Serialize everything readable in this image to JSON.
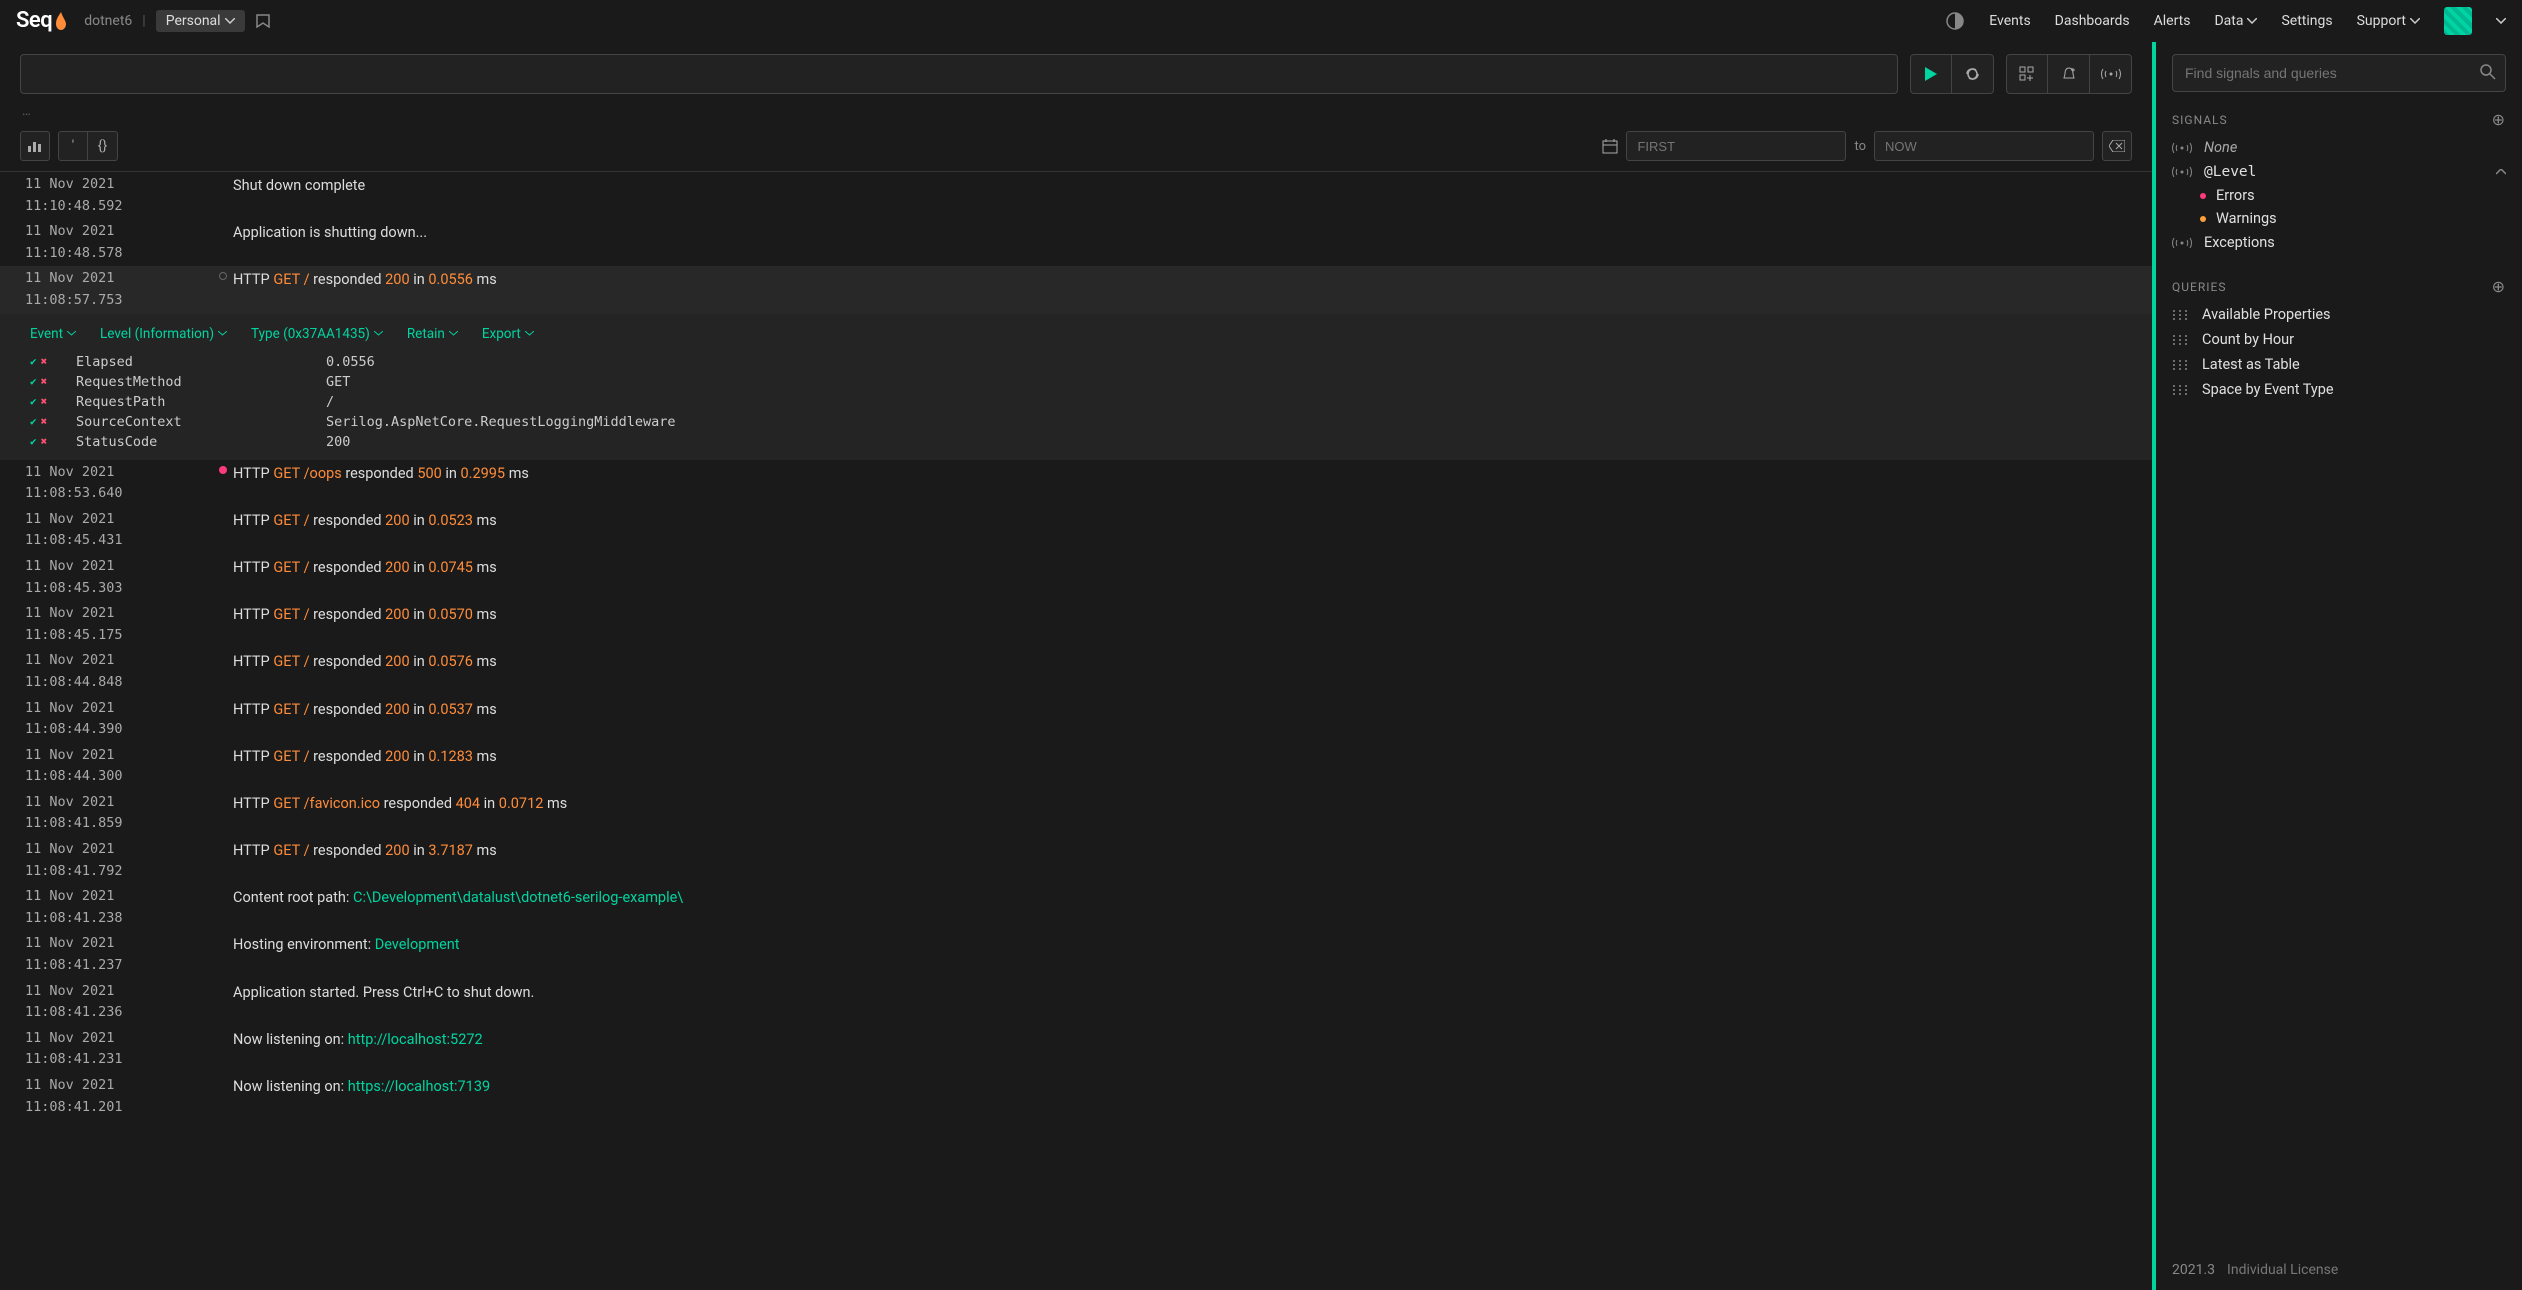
{
  "nav": {
    "brand": "Seq",
    "workspace": "dotnet6",
    "profile": "Personal",
    "links": {
      "events": "Events",
      "dashboards": "Dashboards",
      "alerts": "Alerts",
      "data": "Data",
      "settings": "Settings",
      "support": "Support"
    }
  },
  "search": {
    "query": "",
    "ellipsis": "…",
    "from_placeholder": "FIRST",
    "to_label": "to",
    "to_placeholder": "NOW"
  },
  "detail_menu": {
    "event": "Event",
    "level": "Level (Information)",
    "type": "Type (0x37AA1435)",
    "retain": "Retain",
    "export": "Export"
  },
  "props": [
    {
      "name": "Elapsed",
      "value": "0.0556"
    },
    {
      "name": "RequestMethod",
      "value": "GET"
    },
    {
      "name": "RequestPath",
      "value": "/"
    },
    {
      "name": "SourceContext",
      "value": "Serilog.AspNetCore.RequestLoggingMiddleware"
    },
    {
      "name": "StatusCode",
      "value": "200"
    }
  ],
  "events": {
    "e0": {
      "ts": "11 Nov 2021 11:10:48.592",
      "text": "Shut down complete"
    },
    "e1": {
      "ts": "11 Nov 2021 11:10:48.578",
      "text": "Application is shutting down..."
    },
    "e2": {
      "ts": "11 Nov 2021 11:08:57.753",
      "pre": "HTTP ",
      "method": "GET",
      "sep": " ",
      "path": "/",
      "mid": " responded ",
      "code": "200",
      "in": " in ",
      "ms": "0.0556",
      "suffix": " ms"
    },
    "e3": {
      "ts": "11 Nov 2021 11:08:53.640",
      "pre": "HTTP ",
      "method": "GET",
      "sep": " ",
      "path": "/oops",
      "mid": " responded ",
      "code": "500",
      "in": " in ",
      "ms": "0.2995",
      "suffix": " ms"
    },
    "e4": {
      "ts": "11 Nov 2021 11:08:45.431",
      "pre": "HTTP ",
      "method": "GET",
      "sep": " ",
      "path": "/",
      "mid": " responded ",
      "code": "200",
      "in": " in ",
      "ms": "0.0523",
      "suffix": " ms"
    },
    "e5": {
      "ts": "11 Nov 2021 11:08:45.303",
      "pre": "HTTP ",
      "method": "GET",
      "sep": " ",
      "path": "/",
      "mid": " responded ",
      "code": "200",
      "in": " in ",
      "ms": "0.0745",
      "suffix": " ms"
    },
    "e6": {
      "ts": "11 Nov 2021 11:08:45.175",
      "pre": "HTTP ",
      "method": "GET",
      "sep": " ",
      "path": "/",
      "mid": " responded ",
      "code": "200",
      "in": " in ",
      "ms": "0.0570",
      "suffix": " ms"
    },
    "e7": {
      "ts": "11 Nov 2021 11:08:44.848",
      "pre": "HTTP ",
      "method": "GET",
      "sep": " ",
      "path": "/",
      "mid": " responded ",
      "code": "200",
      "in": " in ",
      "ms": "0.0576",
      "suffix": " ms"
    },
    "e8": {
      "ts": "11 Nov 2021 11:08:44.390",
      "pre": "HTTP ",
      "method": "GET",
      "sep": " ",
      "path": "/",
      "mid": " responded ",
      "code": "200",
      "in": " in ",
      "ms": "0.0537",
      "suffix": " ms"
    },
    "e9": {
      "ts": "11 Nov 2021 11:08:44.300",
      "pre": "HTTP ",
      "method": "GET",
      "sep": " ",
      "path": "/",
      "mid": " responded ",
      "code": "200",
      "in": " in ",
      "ms": "0.1283",
      "suffix": " ms"
    },
    "e10": {
      "ts": "11 Nov 2021 11:08:41.859",
      "pre": "HTTP ",
      "method": "GET",
      "sep": " ",
      "path": "/favicon.ico",
      "mid": " responded ",
      "code": "404",
      "in": " in ",
      "ms": "0.0712",
      "suffix": " ms"
    },
    "e11": {
      "ts": "11 Nov 2021 11:08:41.792",
      "pre": "HTTP ",
      "method": "GET",
      "sep": " ",
      "path": "/",
      "mid": " responded ",
      "code": "200",
      "in": " in ",
      "ms": "3.7187",
      "suffix": " ms"
    },
    "e12": {
      "ts": "11 Nov 2021 11:08:41.238",
      "pre": "Content root path: ",
      "hl": "C:\\Development\\datalust\\dotnet6-serilog-example\\"
    },
    "e13": {
      "ts": "11 Nov 2021 11:08:41.237",
      "pre": "Hosting environment: ",
      "hl": "Development"
    },
    "e14": {
      "ts": "11 Nov 2021 11:08:41.236",
      "text": "Application started. Press Ctrl+C to shut down."
    },
    "e15": {
      "ts": "11 Nov 2021 11:08:41.231",
      "pre": "Now listening on: ",
      "hl": "http://localhost:5272"
    },
    "e16": {
      "ts": "11 Nov 2021 11:08:41.201",
      "pre": "Now listening on: ",
      "hl": "https://localhost:7139"
    }
  },
  "signals": {
    "search_placeholder": "Find signals and queries",
    "header": "SIGNALS",
    "none": "None",
    "level": "@Level",
    "errors": "Errors",
    "warnings": "Warnings",
    "exceptions": "Exceptions"
  },
  "queries": {
    "header": "QUERIES",
    "items": {
      "avail": "Available Properties",
      "count": "Count by Hour",
      "latest": "Latest as Table",
      "space": "Space by Event Type"
    }
  },
  "footer": {
    "version": "2021.3",
    "license": "Individual License"
  }
}
